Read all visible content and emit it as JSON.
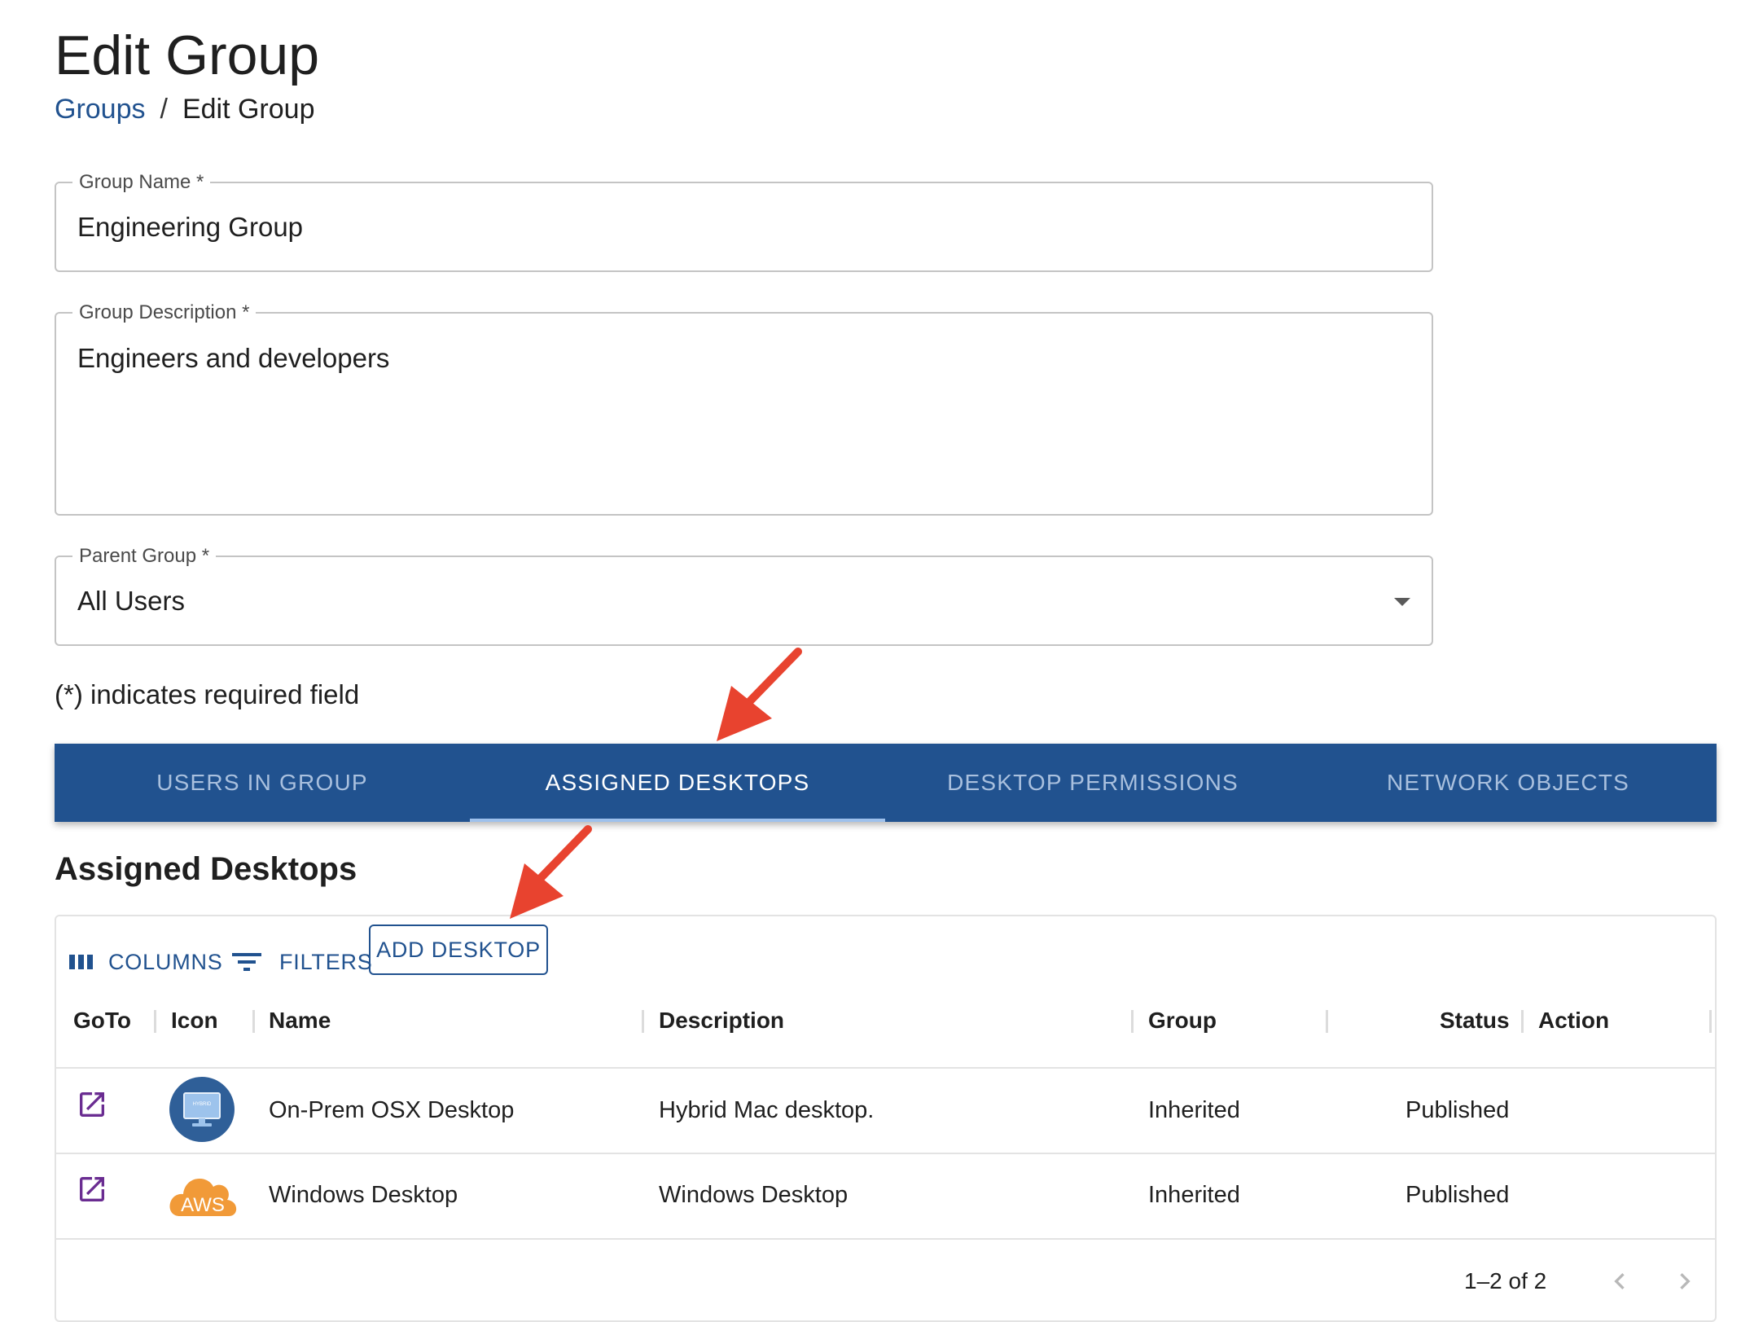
{
  "page": {
    "title": "Edit Group"
  },
  "breadcrumb": {
    "parent": "Groups",
    "separator": "/",
    "current": "Edit Group"
  },
  "form": {
    "group_name": {
      "label": "Group Name *",
      "value": "Engineering Group"
    },
    "group_description": {
      "label": "Group Description *",
      "value": "Engineers and developers"
    },
    "parent_group": {
      "label": "Parent Group *",
      "value": "All Users"
    },
    "required_note": "(*) indicates required field"
  },
  "tabs": [
    {
      "label": "USERS IN GROUP",
      "active": false
    },
    {
      "label": "ASSIGNED DESKTOPS",
      "active": true
    },
    {
      "label": "DESKTOP PERMISSIONS",
      "active": false
    },
    {
      "label": "NETWORK OBJECTS",
      "active": false
    }
  ],
  "section": {
    "title": "Assigned Desktops"
  },
  "toolbar": {
    "columns_label": "COLUMNS",
    "filters_label": "FILTERS",
    "add_desktop_label": "ADD DESKTOP"
  },
  "table": {
    "columns": [
      "GoTo",
      "Icon",
      "Name",
      "Description",
      "Group",
      "Status",
      "Action"
    ],
    "rows": [
      {
        "icon": "hybrid-monitor-icon",
        "icon_badge": "HYBRID",
        "name": "On-Prem OSX Desktop",
        "description": "Hybrid Mac desktop.",
        "group": "Inherited",
        "status": "Published"
      },
      {
        "icon": "aws-cloud-icon",
        "icon_badge": "AWS",
        "name": "Windows Desktop",
        "description": "Windows Desktop",
        "group": "Inherited",
        "status": "Published"
      }
    ],
    "pagination": "1–2 of 2"
  },
  "colors": {
    "primary": "#21528f",
    "tab_inactive_text": "#a9c0de",
    "tab_indicator": "#9ec1ec",
    "goto_icon": "#6a2c91",
    "aws_orange": "#f19a38",
    "annotation_arrow": "#e8432f"
  }
}
